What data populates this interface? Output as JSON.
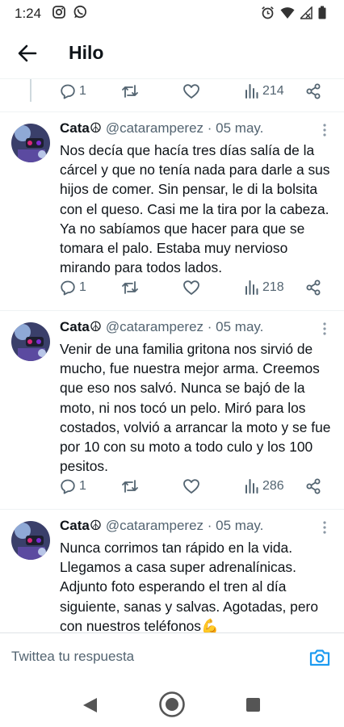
{
  "status_bar": {
    "time": "1:24"
  },
  "header": {
    "title": "Hilo"
  },
  "thread": {
    "top_actions": {
      "replies": "1",
      "views": "214"
    },
    "tweets": [
      {
        "name": "Cata☮",
        "handle": "@cataramperez",
        "separator": "·",
        "date": "05 may.",
        "text": "Nos decía que hacía tres días salía de la cárcel y que no tenía nada para darle a sus hijos de comer. Sin pensar, le di la bolsita con el queso. Casi me la tira por la cabeza. Ya no sabíamos que hacer para que se tomara el palo. Estaba muy nervioso mirando para todos lados.",
        "replies": "1",
        "views": "218"
      },
      {
        "name": "Cata☮",
        "handle": "@cataramperez",
        "separator": "·",
        "date": "05 may.",
        "text": "Venir de una familia gritona nos sirvió de mucho, fue nuestra mejor arma. Creemos que eso nos salvó. Nunca se bajó de la moto, ni nos tocó un pelo. Miró para los costados, volvió a arrancar la moto y se fue por 10 con su moto a todo culo y los 100 pesitos.",
        "replies": "1",
        "views": "286"
      },
      {
        "name": "Cata☮",
        "handle": "@cataramperez",
        "separator": "·",
        "date": "05 may.",
        "text": "Nunca corrimos tan rápido en la vida. Llegamos a casa super adrenalínicas. Adjunto foto esperando el tren al día siguiente, sanas y salvas. Agotadas, pero con nuestros teléfonos💪"
      }
    ]
  },
  "reply_bar": {
    "placeholder": "Twittea tu respuesta"
  },
  "colors": {
    "text": "#0f1419",
    "secondary": "#536471",
    "accent": "#1d9bf0",
    "divider": "#eff3f4"
  },
  "icons": [
    "instagram-icon",
    "whatsapp-icon",
    "alarm-icon",
    "wifi-icon",
    "signal-icon",
    "battery-icon",
    "back-arrow-icon",
    "reply-icon",
    "retweet-icon",
    "like-icon",
    "views-icon",
    "share-icon",
    "more-icon",
    "camera-icon",
    "nav-back-icon",
    "nav-home-icon",
    "nav-recents-icon"
  ]
}
